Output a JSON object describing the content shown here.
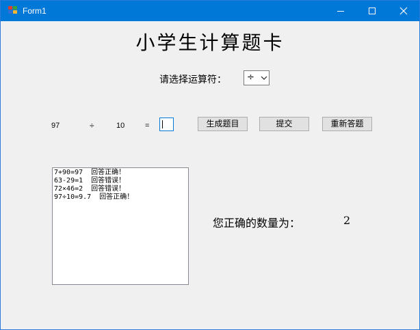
{
  "window": {
    "title": "Form1"
  },
  "header": {
    "title": "小学生计算题卡"
  },
  "operator": {
    "label": "请选择运算符：",
    "selected": "÷"
  },
  "problem": {
    "operand1": "97",
    "operator": "÷",
    "operand2": "10",
    "equals": "=",
    "answer": ""
  },
  "buttons": {
    "generate": "生成题目",
    "submit": "提交",
    "reset": "重新答题"
  },
  "log": [
    "7+90=97  回答正确！",
    "63-29=1  回答错误！",
    "72×46=2  回答错误！",
    "97÷10=9.7  回答正确！"
  ],
  "result": {
    "label": "您正确的数量为：",
    "count": "2"
  },
  "colors": {
    "titlebar": "#0078d7",
    "form_bg": "#f0f0f0"
  }
}
